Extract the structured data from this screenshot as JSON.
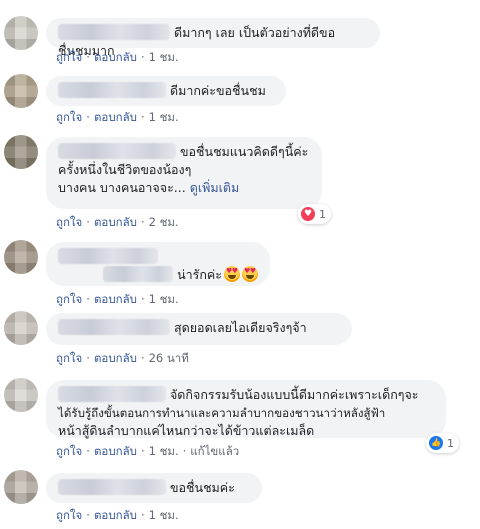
{
  "action_labels": {
    "like": "ถูกใจ",
    "reply": "ตอบกลับ",
    "dot": "·",
    "edited": "แก้ไขแล้ว",
    "see_more": "ดูเพิ่มเติม"
  },
  "comments": [
    {
      "text": "ดีมากๆ เลย เป็นตัวอย่างที่ดีขอชื่นชมมาก",
      "time": "1 ชม."
    },
    {
      "text": "ดีมากค่ะขอชื่นชม",
      "time": "1 ชม."
    },
    {
      "line1": "ขอชื่นชมแนวคิดดีๆนี้ค่ะ",
      "line2": "ครั้งหนึ่งในชีวิตของน้องๆ",
      "line3": "บางคน บางคนอาจจะ...",
      "time": "2 ชม.",
      "reaction": {
        "icon": "heart-icon",
        "count": "1"
      }
    },
    {
      "text": "น่ารักค่ะ",
      "emoji": [
        "heart-eyes-emoji",
        "heart-eyes-emoji"
      ],
      "time": "1 ชม."
    },
    {
      "text": "สุดยอดเลยไอเดียจริงๆจ้า",
      "time": "26 นาที"
    },
    {
      "line1": "จัดกิจกรรมรับน้องแบบนี้ดีมากค่ะเพราะเด็กๆจะ",
      "line2": "ได้รับรู้ถึงขั้นตอนการทำนาและความลำบากของชาวนาว่าหลังสู้ฟ้า",
      "line3": "หน้าสู้ดินลำบากแค่ไหนกว่าจะได้ข้าวแต่ละเมล็ด",
      "time": "1 ชม.",
      "reaction": {
        "icon": "like-icon",
        "count": "1"
      }
    },
    {
      "text": "ขอชื่นชมค่ะ",
      "time": "1 ชม."
    }
  ],
  "colors": {
    "bubble": "#f2f3f5",
    "link": "#385898",
    "meta": "#606770",
    "heart": "#f33e58",
    "like": "#1877f2"
  }
}
